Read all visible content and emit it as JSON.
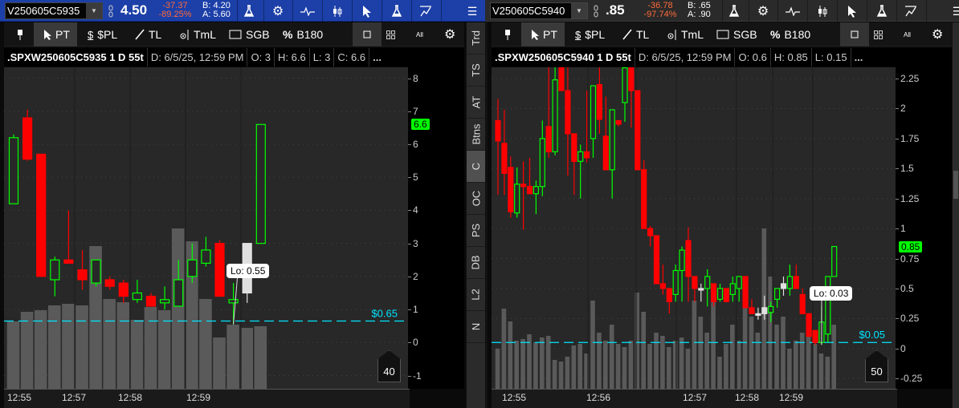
{
  "panels": [
    {
      "symbol": "V250605C5935",
      "last": "4.50",
      "change": "-37.37",
      "change_pct": "-89.25%",
      "bid": "B: 4.20",
      "ask": "A: 5.60",
      "toolbar": {
        "pt": "PT",
        "pl": "$PL",
        "tl": "TL",
        "tml": "TmL",
        "sgb": "SGB",
        "b180": "B180",
        "all": "All"
      },
      "header": {
        "title": ".SPXW250605C5935 1 D 55t",
        "date": "D: 6/5/25, 12:59 PM",
        "open": "O: 3",
        "high": "H: 6.6",
        "low": "L: 3",
        "close": "C: 6.6",
        "more": "..."
      },
      "current_price": "6.6",
      "alert_label": "$0.65",
      "lo_label": "Lo: 0.55",
      "bubble": "40",
      "time_labels": [
        "12:55",
        "12:57",
        "12:58",
        "12:59"
      ]
    },
    {
      "symbol": "V250605C5940",
      "last": ".85",
      "change": "-36.78",
      "change_pct": "-97.74%",
      "bid": "B: .65",
      "ask": "A: .90",
      "toolbar": {
        "pt": "PT",
        "pl": "$PL",
        "tl": "TL",
        "tml": "TmL",
        "sgb": "SGB",
        "b180": "B180",
        "all": "All"
      },
      "header": {
        "title": ".SPXW250605C5940 1 D 55t",
        "date": "D: 6/5/25, 12:59 PM",
        "open": "O: 0.6",
        "high": "H: 0.85",
        "low": "L: 0.15",
        "more": "..."
      },
      "current_price": "0.85",
      "alert_label": "$0.05",
      "lo_label": "Lo: 0.03",
      "bubble": "50",
      "time_labels": [
        "12:55",
        "12:56",
        "12:57",
        "12:58",
        "12:59"
      ]
    }
  ],
  "side_tabs": [
    "Trd",
    "TS",
    "AT",
    "Btns",
    "C",
    "OC",
    "PS",
    "DB",
    "L2",
    "N"
  ],
  "colors": {
    "up": "#00ff00",
    "down": "#ff0000",
    "flat": "#e0e0e0",
    "alert": "#00e5ff",
    "volume": "#5a5a5a",
    "topbar_active": "#1c3fa8"
  },
  "chart_data": [
    {
      "type": "candlestick",
      "ylim": [
        -1.4,
        8.33
      ],
      "yticks": [
        8,
        7,
        6,
        5,
        4,
        3,
        2,
        1,
        0,
        -1
      ],
      "current": 6.6,
      "alert": 0.65,
      "lo": 0.55,
      "flat_idx": [
        17
      ],
      "ohlc": [
        [
          4.2,
          6.3,
          4.2,
          6.2
        ],
        [
          6.8,
          7.05,
          5.5,
          5.55
        ],
        [
          5.7,
          5.7,
          2.0,
          2.0
        ],
        [
          1.9,
          2.6,
          1.4,
          2.5
        ],
        [
          2.5,
          4.0,
          2.4,
          2.4
        ],
        [
          2.2,
          2.8,
          1.6,
          1.9
        ],
        [
          1.8,
          2.5,
          1.7,
          2.5
        ],
        [
          1.9,
          2.0,
          1.6,
          1.7
        ],
        [
          1.8,
          1.9,
          1.2,
          1.4
        ],
        [
          1.3,
          1.9,
          1.2,
          1.5
        ],
        [
          1.4,
          1.5,
          1.1,
          1.1
        ],
        [
          1.2,
          1.7,
          1.0,
          1.3
        ],
        [
          1.1,
          2.5,
          1.1,
          1.9
        ],
        [
          2.0,
          3.0,
          1.8,
          2.5
        ],
        [
          2.4,
          3.2,
          2.3,
          2.8
        ],
        [
          3.0,
          3.1,
          1.4,
          1.4
        ],
        [
          1.2,
          1.8,
          0.55,
          1.3
        ],
        [
          1.5,
          3.0,
          1.2,
          3.0
        ],
        [
          3.0,
          6.6,
          3.0,
          6.6
        ]
      ],
      "volume": [
        42,
        48,
        49,
        52,
        53,
        52,
        89,
        56,
        54,
        43,
        51,
        49,
        100,
        92,
        56,
        32,
        40,
        38,
        39
      ]
    },
    {
      "type": "candlestick",
      "ylim": [
        -0.336,
        2.344
      ],
      "yticks": [
        2.25,
        2,
        1.75,
        1.5,
        1.25,
        1,
        0.75,
        0.5,
        0.25,
        0,
        -0.25
      ],
      "current": 0.85,
      "alert": 0.05,
      "lo": 0.03,
      "flat_idx": [
        32,
        41,
        42,
        45
      ],
      "ohlc": [
        [
          1.9,
          2.08,
          1.28,
          1.73
        ],
        [
          1.71,
          1.99,
          1.28,
          1.46
        ],
        [
          1.51,
          1.6,
          1.09,
          1.14
        ],
        [
          1.13,
          1.51,
          1.09,
          1.37
        ],
        [
          1.37,
          1.56,
          0.99,
          1.35
        ],
        [
          1.35,
          1.59,
          1.29,
          1.29
        ],
        [
          1.29,
          1.4,
          1.12,
          1.35
        ],
        [
          1.35,
          1.9,
          1.27,
          1.75
        ],
        [
          1.85,
          2.37,
          1.59,
          1.64
        ],
        [
          1.64,
          2.37,
          1.61,
          2.24
        ],
        [
          2.37,
          2.37,
          2.15,
          2.15
        ],
        [
          2.15,
          2.35,
          1.44,
          1.79
        ],
        [
          1.79,
          1.79,
          1.28,
          1.56
        ],
        [
          1.56,
          1.7,
          1.25,
          1.64
        ],
        [
          1.64,
          2.15,
          1.55,
          1.59
        ],
        [
          1.75,
          2.19,
          1.59,
          2.19
        ],
        [
          2.2,
          2.37,
          1.79,
          1.91
        ],
        [
          1.77,
          2.1,
          1.49,
          1.49
        ],
        [
          1.49,
          1.99,
          1.25,
          1.99
        ],
        [
          1.9,
          1.9,
          1.85,
          1.87
        ],
        [
          2.05,
          2.37,
          1.89,
          2.34
        ],
        [
          2.37,
          2.37,
          1.84,
          2.15
        ],
        [
          2.15,
          2.15,
          1.49,
          1.49
        ],
        [
          1.49,
          1.57,
          1.0,
          1.0
        ],
        [
          1.0,
          1.02,
          0.85,
          0.94
        ],
        [
          0.94,
          0.94,
          0.54,
          0.54
        ],
        [
          0.54,
          0.7,
          0.45,
          0.5
        ],
        [
          0.5,
          0.5,
          0.29,
          0.39
        ],
        [
          0.45,
          0.7,
          0.39,
          0.65
        ],
        [
          0.65,
          0.85,
          0.39,
          0.82
        ],
        [
          0.9,
          1.01,
          0.39,
          0.6
        ],
        [
          0.6,
          0.6,
          0.39,
          0.5
        ],
        [
          0.5,
          0.54,
          0.39,
          0.5
        ],
        [
          0.5,
          0.66,
          0.35,
          0.6
        ],
        [
          0.54,
          0.54,
          0.35,
          0.39
        ],
        [
          0.41,
          0.54,
          0.39,
          0.5
        ],
        [
          0.5,
          0.5,
          0.39,
          0.39
        ],
        [
          0.45,
          0.6,
          0.39,
          0.54
        ],
        [
          0.5,
          0.6,
          0.39,
          0.6
        ],
        [
          0.6,
          0.6,
          0.34,
          0.34
        ],
        [
          0.34,
          0.41,
          0.29,
          0.29
        ],
        [
          0.29,
          0.34,
          0.24,
          0.29
        ],
        [
          0.29,
          0.44,
          0.24,
          0.34
        ],
        [
          0.3,
          0.39,
          0.22,
          0.35
        ],
        [
          0.41,
          0.5,
          0.34,
          0.5
        ],
        [
          0.5,
          0.6,
          0.44,
          0.54
        ],
        [
          0.5,
          0.7,
          0.44,
          0.6
        ],
        [
          0.6,
          0.7,
          0.5,
          0.5
        ],
        [
          0.45,
          0.5,
          0.29,
          0.29
        ],
        [
          0.29,
          0.29,
          0.1,
          0.1
        ],
        [
          0.15,
          0.15,
          0.03,
          0.05
        ],
        [
          0.05,
          0.35,
          0.03,
          0.22
        ],
        [
          0.12,
          0.6,
          0.05,
          0.6
        ],
        [
          0.6,
          0.85,
          0.6,
          0.85
        ]
      ],
      "volume": [
        25,
        50,
        42,
        30,
        31,
        34,
        29,
        32,
        33,
        18,
        17,
        20,
        27,
        28,
        22,
        55,
        35,
        30,
        40,
        28,
        26,
        30,
        60,
        48,
        28,
        35,
        33,
        26,
        30,
        32,
        25,
        55,
        45,
        35,
        55,
        20,
        28,
        40,
        30,
        60,
        45,
        35,
        100,
        70,
        40,
        45,
        25,
        30,
        35,
        35,
        28,
        22,
        20,
        40
      ]
    }
  ]
}
